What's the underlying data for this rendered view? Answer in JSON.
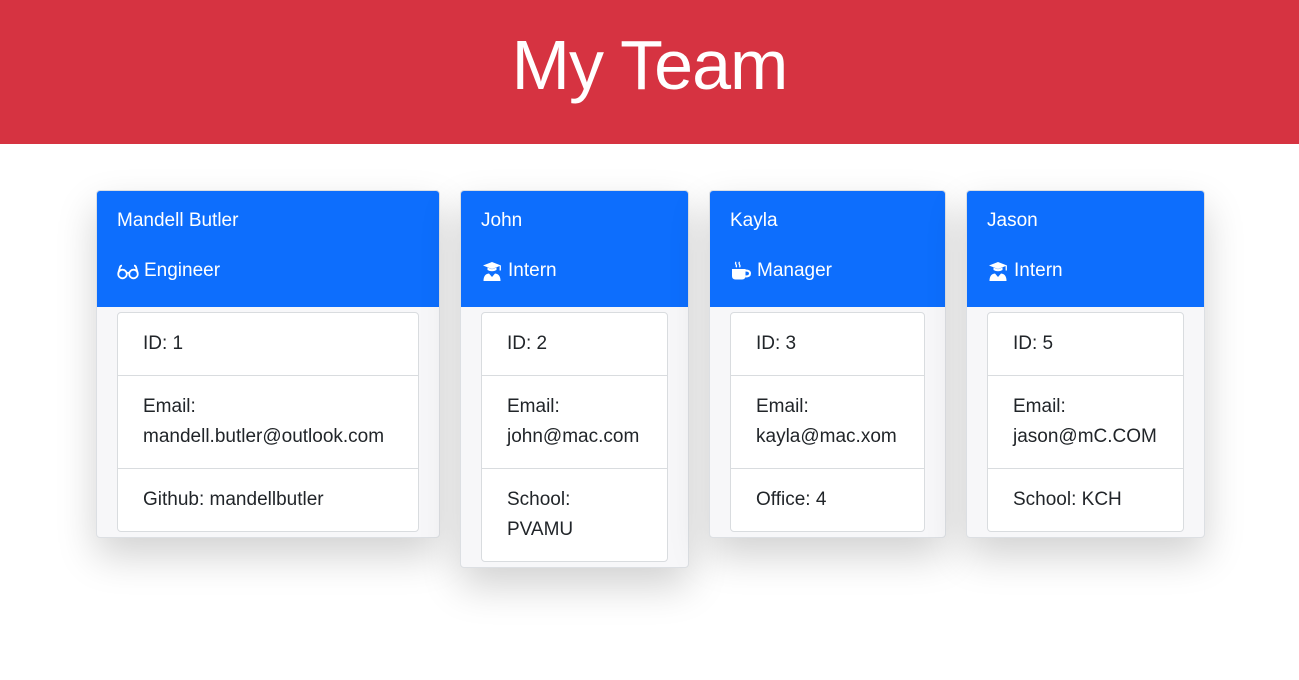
{
  "header": {
    "title": "My Team"
  },
  "colors": {
    "header_bg": "#d63341",
    "card_header_bg": "#0d6efd"
  },
  "cards": [
    {
      "name": "Mandell Butler",
      "role": "Engineer",
      "role_icon": "glasses-icon",
      "id_label": "ID: 1",
      "email_prefix": "Email:",
      "email": "mandell.butler@outlook.com",
      "extra_line1": "Github: mandellbutler",
      "extra_line2": ""
    },
    {
      "name": "John",
      "role": "Intern",
      "role_icon": "graduate-icon",
      "id_label": "ID: 2",
      "email_prefix": "Email:",
      "email": "john@mac.com",
      "extra_line1": "School:",
      "extra_line2": "PVAMU"
    },
    {
      "name": "Kayla",
      "role": "Manager",
      "role_icon": "coffee-icon",
      "id_label": "ID: 3",
      "email_prefix": "Email:",
      "email": "kayla@mac.xom",
      "extra_line1": "Office: 4",
      "extra_line2": ""
    },
    {
      "name": "Jason",
      "role": "Intern",
      "role_icon": "graduate-icon",
      "id_label": "ID: 5",
      "email_prefix": "Email:",
      "email": "jason@mC.COM",
      "extra_line1": "School: KCH",
      "extra_line2": ""
    }
  ]
}
